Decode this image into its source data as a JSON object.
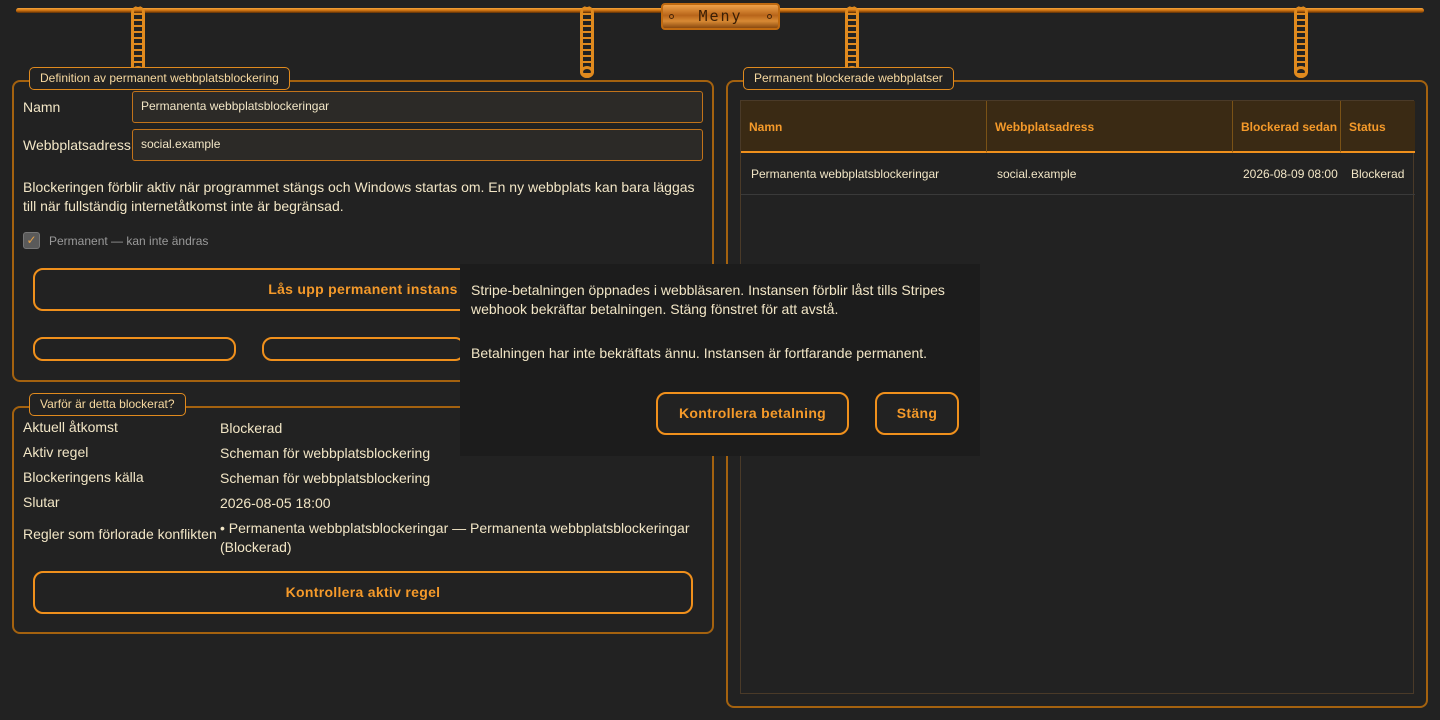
{
  "menu": {
    "label": "Meny"
  },
  "definition": {
    "legend": "Definition av permanent webbplatsblockering",
    "name_label": "Namn",
    "name_value": "Permanenta webbplatsblockeringar",
    "address_label": "Webbplatsadress",
    "address_value": "social.example",
    "description": "Blockeringen förblir aktiv när programmet stängs och Windows startas om. En ny webbplats kan bara läggas till när fullständig internetåtkomst inte är begränsad.",
    "permanent_label": "Permanent — kan inte ändras",
    "permanent_checked": true,
    "unlock_button": "Lås upp permanent instans"
  },
  "why": {
    "legend": "Varför är detta blockerat?",
    "rows": [
      {
        "key": "Aktuell åtkomst",
        "value": "Blockerad"
      },
      {
        "key": "Aktiv regel",
        "value": "Scheman för webbplatsblockering"
      },
      {
        "key": "Blockeringens källa",
        "value": "Scheman för webbplatsblockering"
      },
      {
        "key": "Slutar",
        "value": "2026-08-05 18:00"
      },
      {
        "key": "Regler som förlorade konflikten",
        "value": "• Permanenta webbplatsblockeringar — Permanenta webbplatsblockeringar (Blockerad)"
      }
    ],
    "check_button": "Kontrollera aktiv regel"
  },
  "blocked": {
    "legend": "Permanent blockerade webbplatser",
    "columns": [
      "Namn",
      "Webbplatsadress",
      "Blockerad sedan",
      "Status"
    ],
    "rows": [
      [
        "Permanenta webbplatsblockeringar",
        "social.example",
        "2026-08-09 08:00",
        "Blockerad"
      ]
    ]
  },
  "dialog": {
    "message1": "Stripe-betalningen öppnades i webbläsaren. Instansen förblir låst tills Stripes webhook bekräftar betalningen. Stäng fönstret för att avstå.",
    "message2": "Betalningen har inte bekräftats ännu. Instansen är fortfarande permanent.",
    "check_payment_button": "Kontrollera betalning",
    "close_button": "Stäng"
  },
  "colors": {
    "accent": "#f0901c",
    "background": "#222222",
    "text": "#f2e6c6"
  }
}
